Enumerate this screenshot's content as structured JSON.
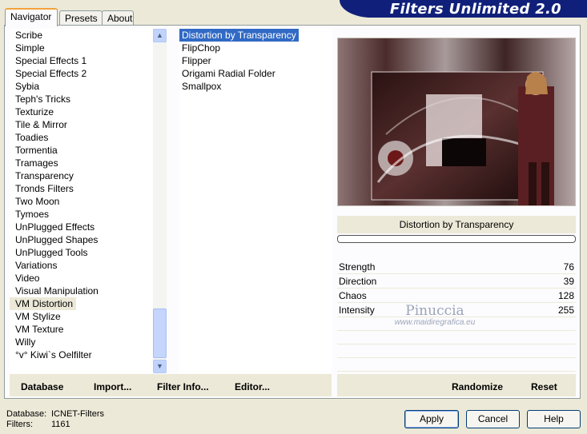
{
  "header": {
    "title": "Filters Unlimited 2.0"
  },
  "tabs": [
    {
      "label": "Navigator",
      "active": true
    },
    {
      "label": "Presets",
      "active": false
    },
    {
      "label": "About",
      "active": false
    }
  ],
  "categories": {
    "items": [
      "Scribe",
      "Simple",
      "Special Effects 1",
      "Special Effects 2",
      "Sybia",
      "Teph's Tricks",
      "Texturize",
      "Tile & Mirror",
      "Toadies",
      "Tormentia",
      "Tramages",
      "Transparency",
      "Tronds Filters",
      "Two Moon",
      "Tymoes",
      "UnPlugged Effects",
      "UnPlugged Shapes",
      "UnPlugged Tools",
      "Variations",
      "Video",
      "Visual Manipulation",
      "VM Distortion",
      "VM Stylize",
      "VM Texture",
      "Willy",
      "°v° Kiwi`s Oelfilter"
    ],
    "selected": "VM Distortion"
  },
  "filters": {
    "items": [
      "Distortion by Transparency",
      "FlipChop",
      "Flipper",
      "Origami Radial Folder",
      "Smallpox"
    ],
    "selected": "Distortion by Transparency"
  },
  "preview": {
    "filter_name": "Distortion by Transparency"
  },
  "params": [
    {
      "name": "Strength",
      "value": "76"
    },
    {
      "name": "Direction",
      "value": "39"
    },
    {
      "name": "Chaos",
      "value": "128"
    },
    {
      "name": "Intensity",
      "value": "255"
    }
  ],
  "watermark": {
    "name": "Pinuccia",
    "url": "www.maidiregrafica.eu"
  },
  "toolbar_left": {
    "database": "Database",
    "import": "Import...",
    "filter_info": "Filter Info...",
    "editor": "Editor..."
  },
  "toolbar_right": {
    "randomize": "Randomize",
    "reset": "Reset"
  },
  "status": {
    "database_label": "Database:",
    "database_value": "ICNET-Filters",
    "filters_label": "Filters:",
    "filters_value": "1161"
  },
  "buttons": {
    "apply": "Apply",
    "cancel": "Cancel",
    "help": "Help"
  },
  "colors": {
    "banner": "#10207a",
    "selection": "#316ac5",
    "face": "#ece9d8"
  },
  "icons": {
    "scroll_up": "chevron-up-icon",
    "scroll_down": "chevron-down-icon"
  }
}
